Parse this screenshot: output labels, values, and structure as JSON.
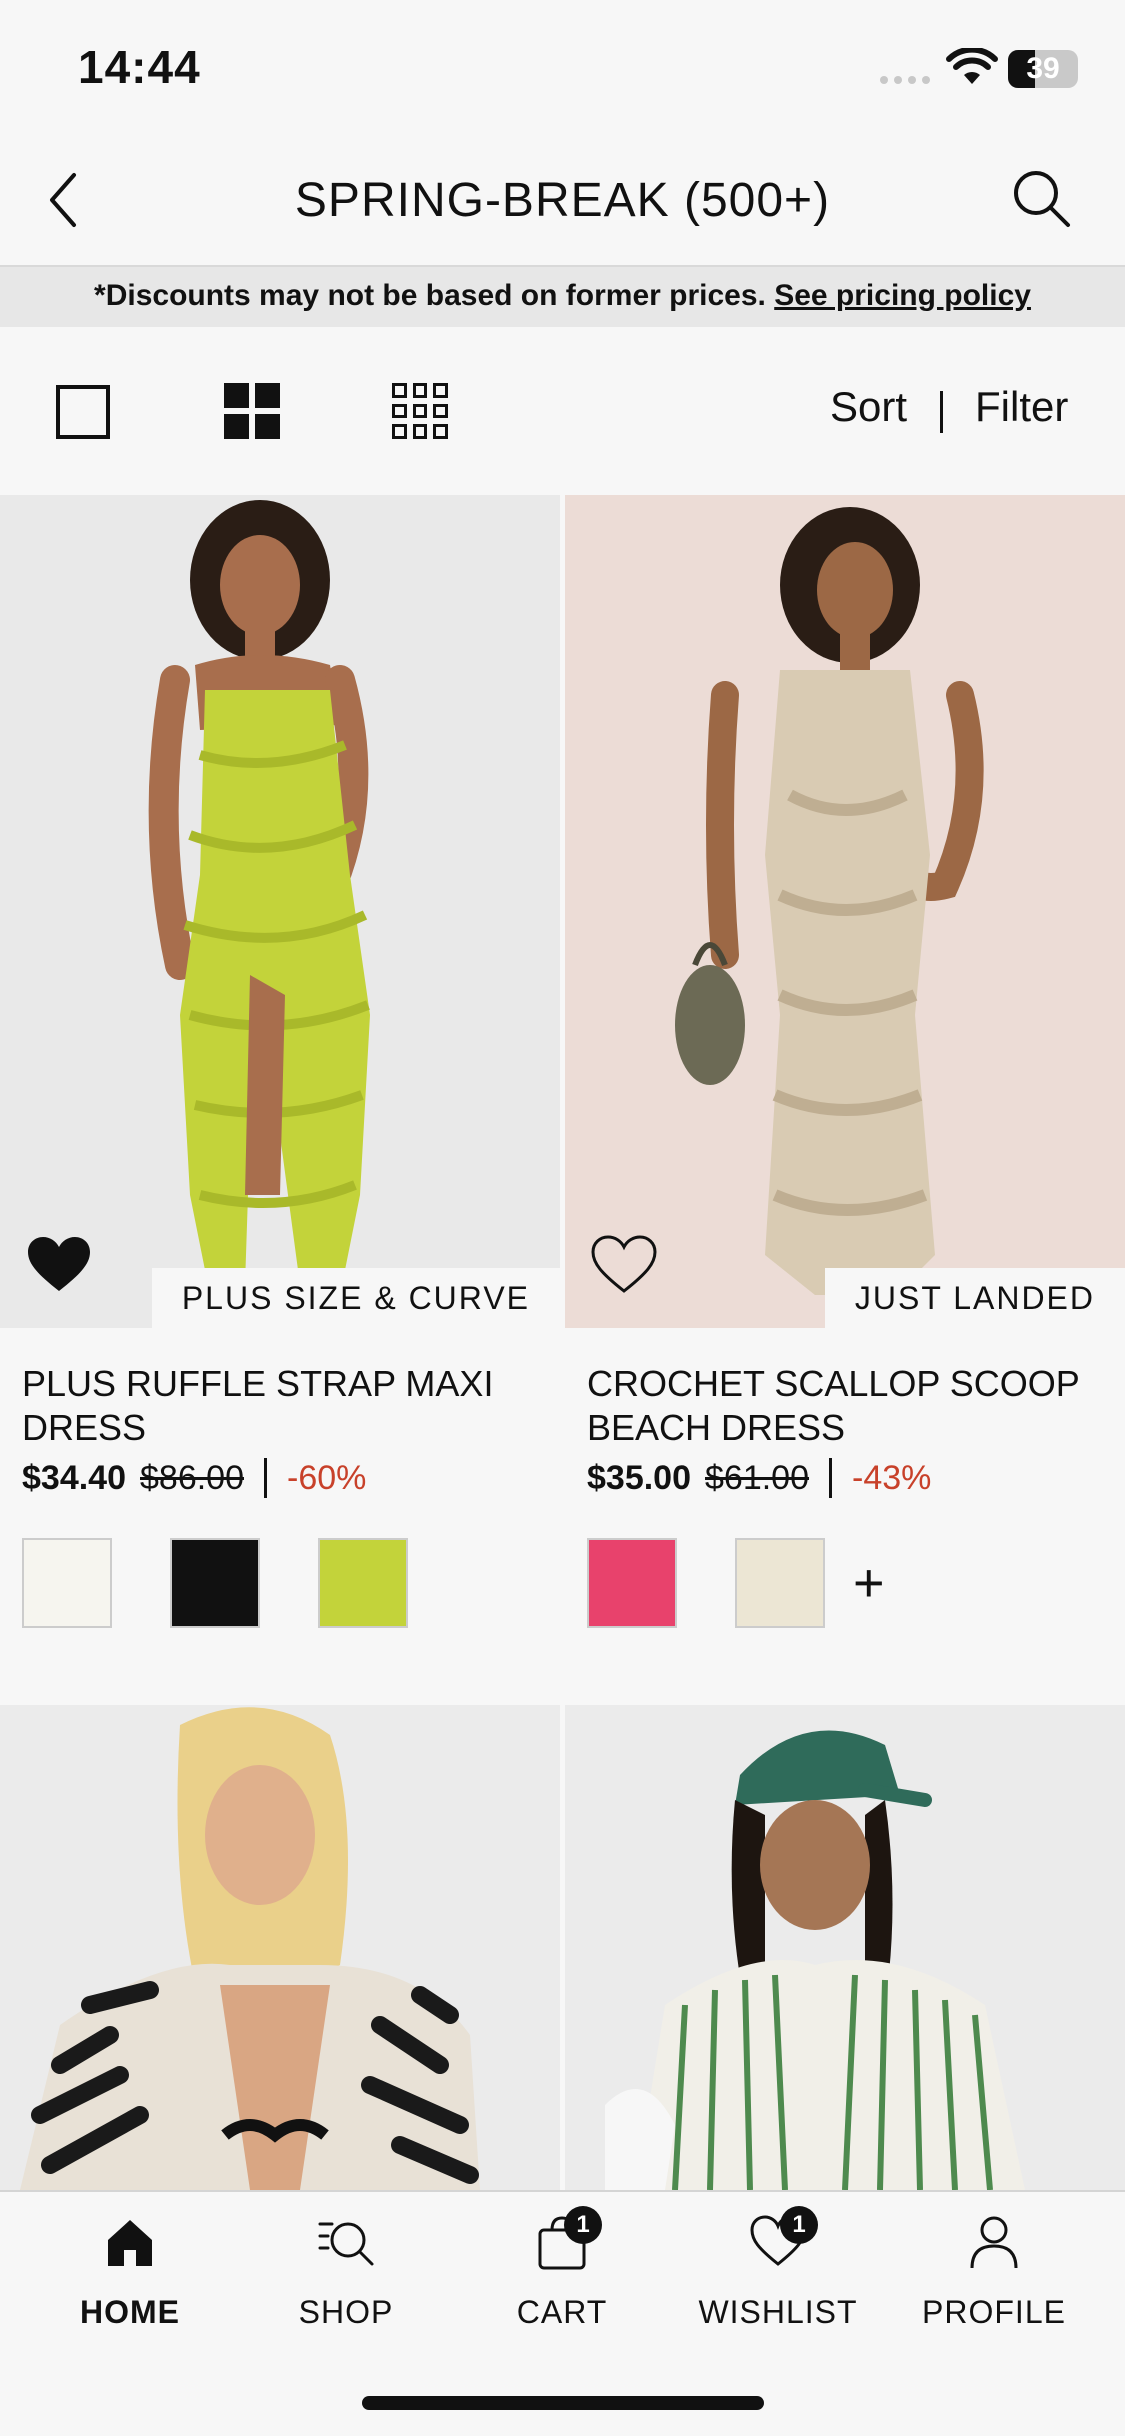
{
  "status": {
    "time": "14:44",
    "battery": "39",
    "battery_level": 0.39
  },
  "header": {
    "title": "SPRING-BREAK (500+)"
  },
  "notice": {
    "text": "*Discounts may not be based on former prices.",
    "link": "See pricing policy"
  },
  "toolbar": {
    "sort": "Sort",
    "filter": "Filter"
  },
  "products": [
    {
      "name": "PLUS RUFFLE STRAP MAXI DRESS",
      "price": "$34.40",
      "was": "$86.00",
      "off": "-60%",
      "badge": "PLUS SIZE & CURVE",
      "wishlisted": true,
      "swatches": [
        "#f6f5ef",
        "#111111",
        "#c3d33a"
      ],
      "more_colors": ""
    },
    {
      "name": "CROCHET SCALLOP SCOOP BEACH DRESS",
      "price": "$35.00",
      "was": "$61.00",
      "off": "-43%",
      "badge": "JUST LANDED",
      "wishlisted": false,
      "swatches": [
        "#e8426c",
        "#ece6d4"
      ],
      "more_colors": "+"
    }
  ],
  "tabs": [
    {
      "label": "HOME",
      "icon": "home-icon"
    },
    {
      "label": "SHOP",
      "icon": "shop-search-icon"
    },
    {
      "label": "CART",
      "icon": "bag-icon",
      "badge": "1"
    },
    {
      "label": "WISHLIST",
      "icon": "heart-icon",
      "badge": "1"
    },
    {
      "label": "PROFILE",
      "icon": "person-icon"
    }
  ],
  "colors": {
    "discount": "#c8412a",
    "lime": "#c3d33a",
    "crochet": "#d9cbb3",
    "background": "#f7f7f7"
  }
}
